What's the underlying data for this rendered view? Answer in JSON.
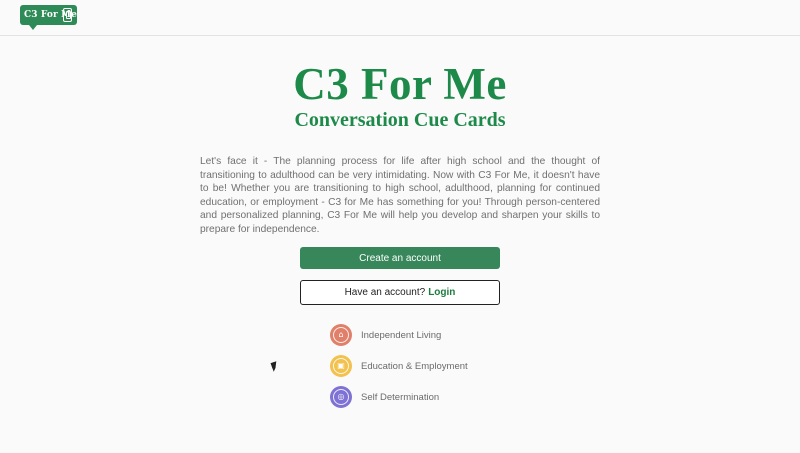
{
  "header": {
    "logo_text": "C3 For Me",
    "logo_icon": "tablet-icon"
  },
  "hero": {
    "title": "C3 For Me",
    "subtitle": "Conversation Cue Cards"
  },
  "intro_text": "Let's face it - The planning process for life after high school and the thought of transitioning to adulthood can be very intimidating. Now with C3 For Me, it doesn't have to be! Whether you are transitioning to high school, adulthood, planning for continued education, or employment - C3 for Me has something for you! Through person-centered and personalized planning, C3 For Me will help you develop and sharpen your skills to prepare for independence.",
  "buttons": {
    "create_account": "Create an account",
    "have_account": "Have an account?",
    "login": "Login"
  },
  "topics": [
    {
      "label": "Independent Living",
      "icon": "house-icon",
      "color": "#e0806a",
      "glyph": "⌂"
    },
    {
      "label": "Education & Employment",
      "icon": "briefcase-icon",
      "color": "#f2c14e",
      "glyph": "▣"
    },
    {
      "label": "Self Determination",
      "icon": "target-icon",
      "color": "#7e72d4",
      "glyph": "◎"
    }
  ],
  "colors": {
    "brand_green": "#1e8a4a",
    "button_green": "#37875a",
    "background": "#fafafa"
  }
}
